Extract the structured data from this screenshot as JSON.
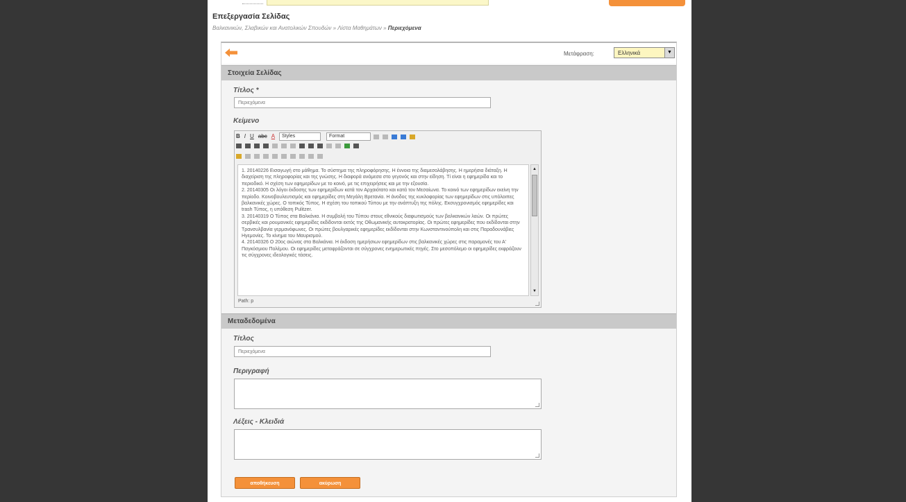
{
  "page": {
    "title": "Επεξεργασία Σελίδας",
    "breadcrumb": {
      "items": [
        "Βαλκανικών, Σλαβικών και Ανατολικών Σπουδών",
        "Λίστα Μαθημάτων"
      ],
      "separator": "»",
      "current": "Περιεχόμενα"
    }
  },
  "toolbar": {
    "translation_label": "Μετάφραση:",
    "language_value": "Ελληνικά"
  },
  "sections": {
    "page_details": "Στοιχεία Σελίδας",
    "metadata": "Μεταδεδομένα"
  },
  "fields": {
    "title_label": "Τίτλος *",
    "title_value": "Περιεχόμενα",
    "content_label": "Κείμενο",
    "meta_title_label": "Τίτλος",
    "meta_title_value": "Περιεχόμενα",
    "description_label": "Περιγραφή",
    "keywords_label": "Λέξεις - Κλειδιά"
  },
  "editor": {
    "styles_select": "Styles",
    "format_select": "Format",
    "path": "Path: p",
    "paragraphs": [
      "1. 20140226 Εισαγωγή στο μάθημα. Το σύστημα της πληροφόρησης. Η έννοια της διαμεσολάβησης. Η ημερήσια διάταξη. Η διαχείριση της πληροφορίας και της γνώσης. Η διαφορά ανάμεσα στο γεγονός και στην είδηση. Τί είναι η εφημερίδα και το περιοδικό. Η σχέση των εφημερίδων με το κοινό, με τις επιχειρήσεις και με την εξουσία.",
      "2. 20140305 Οι λόγοι έκδοσης των εφημερίδων κατά τον Αρχαιότατο και κατά τον Μεσαίωνα. Το κοινό των εφημερίδων εκείνη την περίοδο. Κοινοβουλευτισμός και εφημερίδες στη Μεγάλη Βρετανία. Η άνοδος της κυκλοφορίας των εφημερίδων στις υπόλοιπες βαλκανικές χώρες. Ο τοπικός Τύπος. Η σχέση του τοπικού Τύπου με την ανάπτυξη της πόλης. Εκσυγχρονισμός εφημερίδες και trash Τύπος, η υπόθεση Pulitzer.",
      "3. 20140319 Ο Τύπος στα Βαλκάνια. Η συμβολή του Τύπου στους εθνικούς διαφωτισμούς των βαλκανικών λαών. Οι πρώτες σερβικές και ρουμανικές εφημερίδες εκδίδονται εκτός της Οθωμανικής αυτοκρατορίας. Οι πρώτες εφημερίδες που εκδίδονται στην Τρανσυλβανία γερμανόφωνες. Οι πρώτες βουλγαρικές εφημερίδες εκδίδονται στην Κωνσταντινούπολη και στις Παραδουνάβιες Ηγεμονίες. Το κίνημα του Μαυρισμού.",
      "4. 20140326 Ο 20ος αιώνας στα Βαλκάνια. Η έκδοση ημερήσιων εφημερίδων στις βαλκανικές χώρες στις παραμονές του Α' Παγκόσμιου Πολέμου. Οι εφημερίδες μεταφράζονται σε σύγχρονες ενημερωτικές πηγές. Στο μεσοπόλεμο οι εφημερίδες εκφράζουν τις σύγχρονες ιδεολογικές τάσεις."
    ]
  },
  "buttons": {
    "save": "αποθήκευση",
    "cancel": "ακύρωση"
  },
  "icons": {
    "back": "back-arrow-icon",
    "dropdown": "chevron-down-icon"
  },
  "colors": {
    "accent": "#f4913a",
    "background": "#363636",
    "section_header": "#c9c9c9"
  }
}
